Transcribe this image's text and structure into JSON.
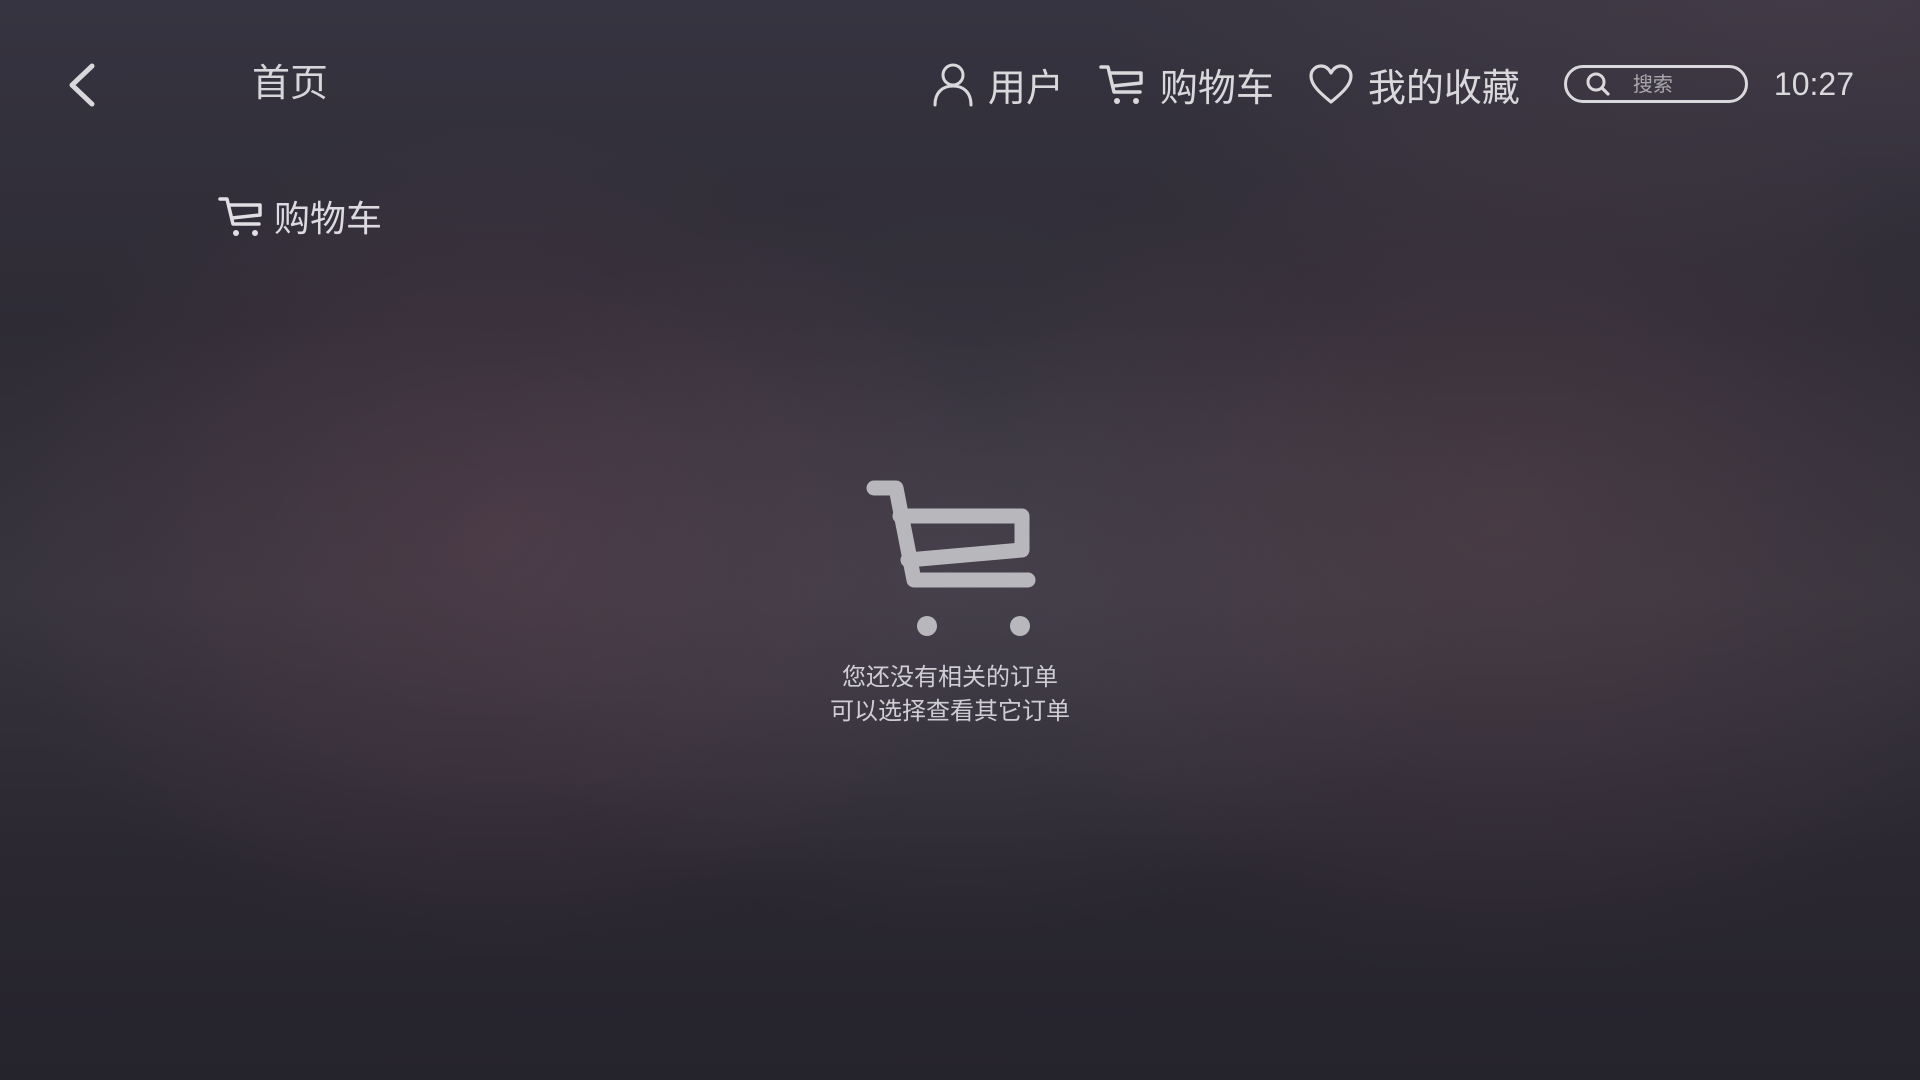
{
  "header": {
    "back_icon": "chevron-left-icon",
    "home_label": "首页",
    "nav": {
      "user_label": "用户",
      "user_icon": "user-icon",
      "cart_label": "购物车",
      "cart_icon": "cart-icon",
      "favorites_label": "我的收藏",
      "favorites_icon": "heart-icon"
    },
    "search": {
      "placeholder": "搜索",
      "value": "",
      "icon": "search-icon"
    },
    "clock": "10:27"
  },
  "section": {
    "title": "购物车",
    "icon": "cart-icon"
  },
  "empty_state": {
    "icon": "cart-icon",
    "line1": "您还没有相关的订单",
    "line2": "可以选择查看其它订单"
  },
  "colors": {
    "text": "#d9d9dc",
    "icon_gray": "#b8b8bc",
    "background": "#2c2933"
  }
}
